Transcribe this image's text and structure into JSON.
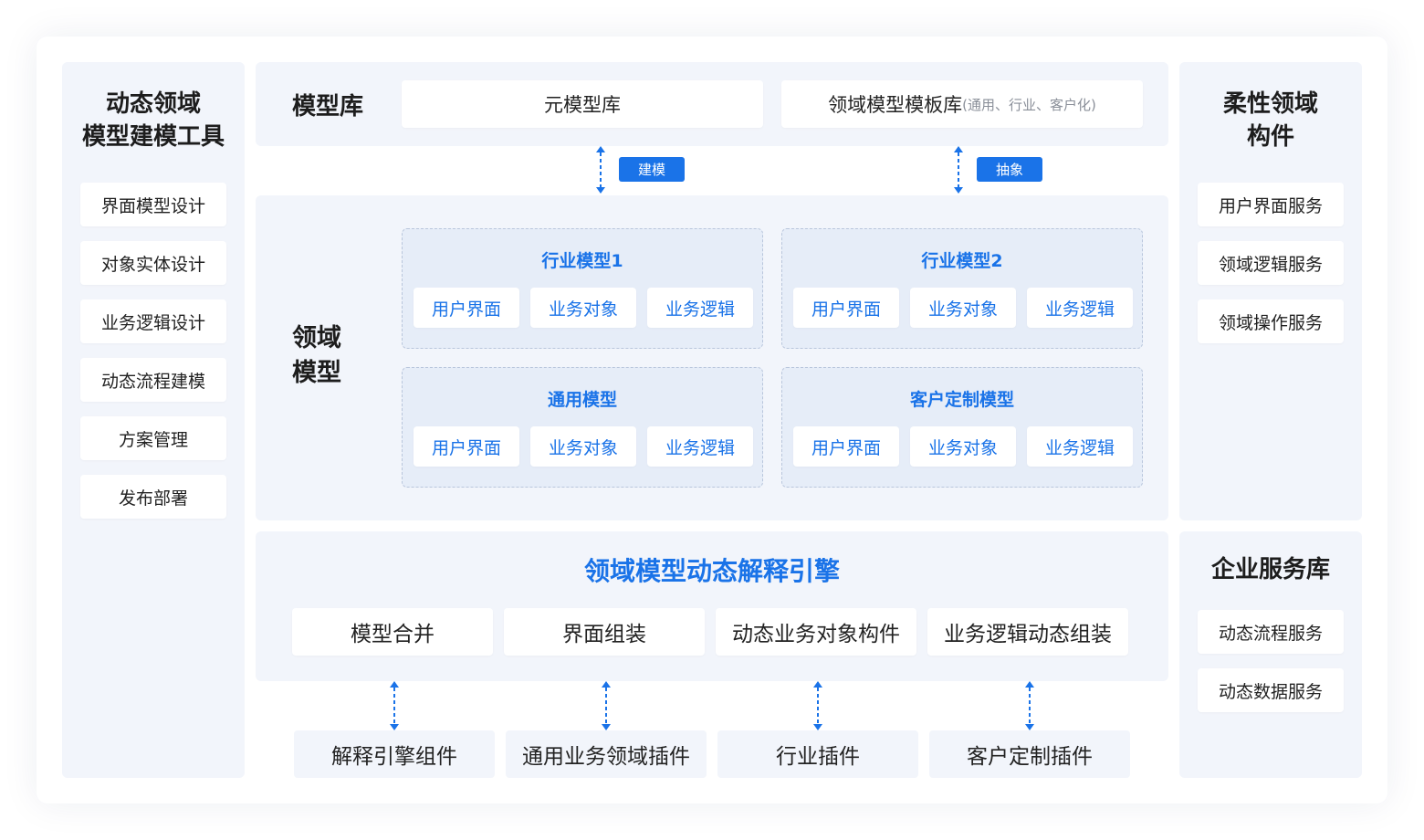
{
  "left_panel": {
    "title_line1": "动态领域",
    "title_line2": "模型建模工具",
    "items": [
      "界面模型设计",
      "对象实体设计",
      "业务逻辑设计",
      "动态流程建模",
      "方案管理",
      "发布部署"
    ]
  },
  "model_library": {
    "title": "模型库",
    "meta_library": "元模型库",
    "template_library": "领域模型模板库",
    "template_library_note": "(通用、行业、客户化)"
  },
  "connectors_top": {
    "left_label": "建模",
    "right_label": "抽象"
  },
  "domain_model": {
    "title_line1": "领域",
    "title_line2": "模型",
    "groups": [
      {
        "title": "行业模型1",
        "chips": [
          "用户界面",
          "业务对象",
          "业务逻辑"
        ]
      },
      {
        "title": "行业模型2",
        "chips": [
          "用户界面",
          "业务对象",
          "业务逻辑"
        ]
      },
      {
        "title": "通用模型",
        "chips": [
          "用户界面",
          "业务对象",
          "业务逻辑"
        ]
      },
      {
        "title": "客户定制模型",
        "chips": [
          "用户界面",
          "业务对象",
          "业务逻辑"
        ]
      }
    ]
  },
  "engine": {
    "title": "领域模型动态解释引擎",
    "items": [
      "模型合并",
      "界面组装",
      "动态业务对象构件",
      "业务逻辑动态组装"
    ]
  },
  "plugins": [
    "解释引擎组件",
    "通用业务领域插件",
    "行业插件",
    "客户定制插件"
  ],
  "right_top": {
    "title_line1": "柔性领域",
    "title_line2": "构件",
    "items": [
      "用户界面服务",
      "领域逻辑服务",
      "领域操作服务"
    ]
  },
  "right_bottom": {
    "title": "企业服务库",
    "items": [
      "动态流程服务",
      "动态数据服务"
    ]
  },
  "colors": {
    "accent": "#1a73e8",
    "panel_bg": "#f2f5fb",
    "group_bg": "#e6edf8"
  }
}
